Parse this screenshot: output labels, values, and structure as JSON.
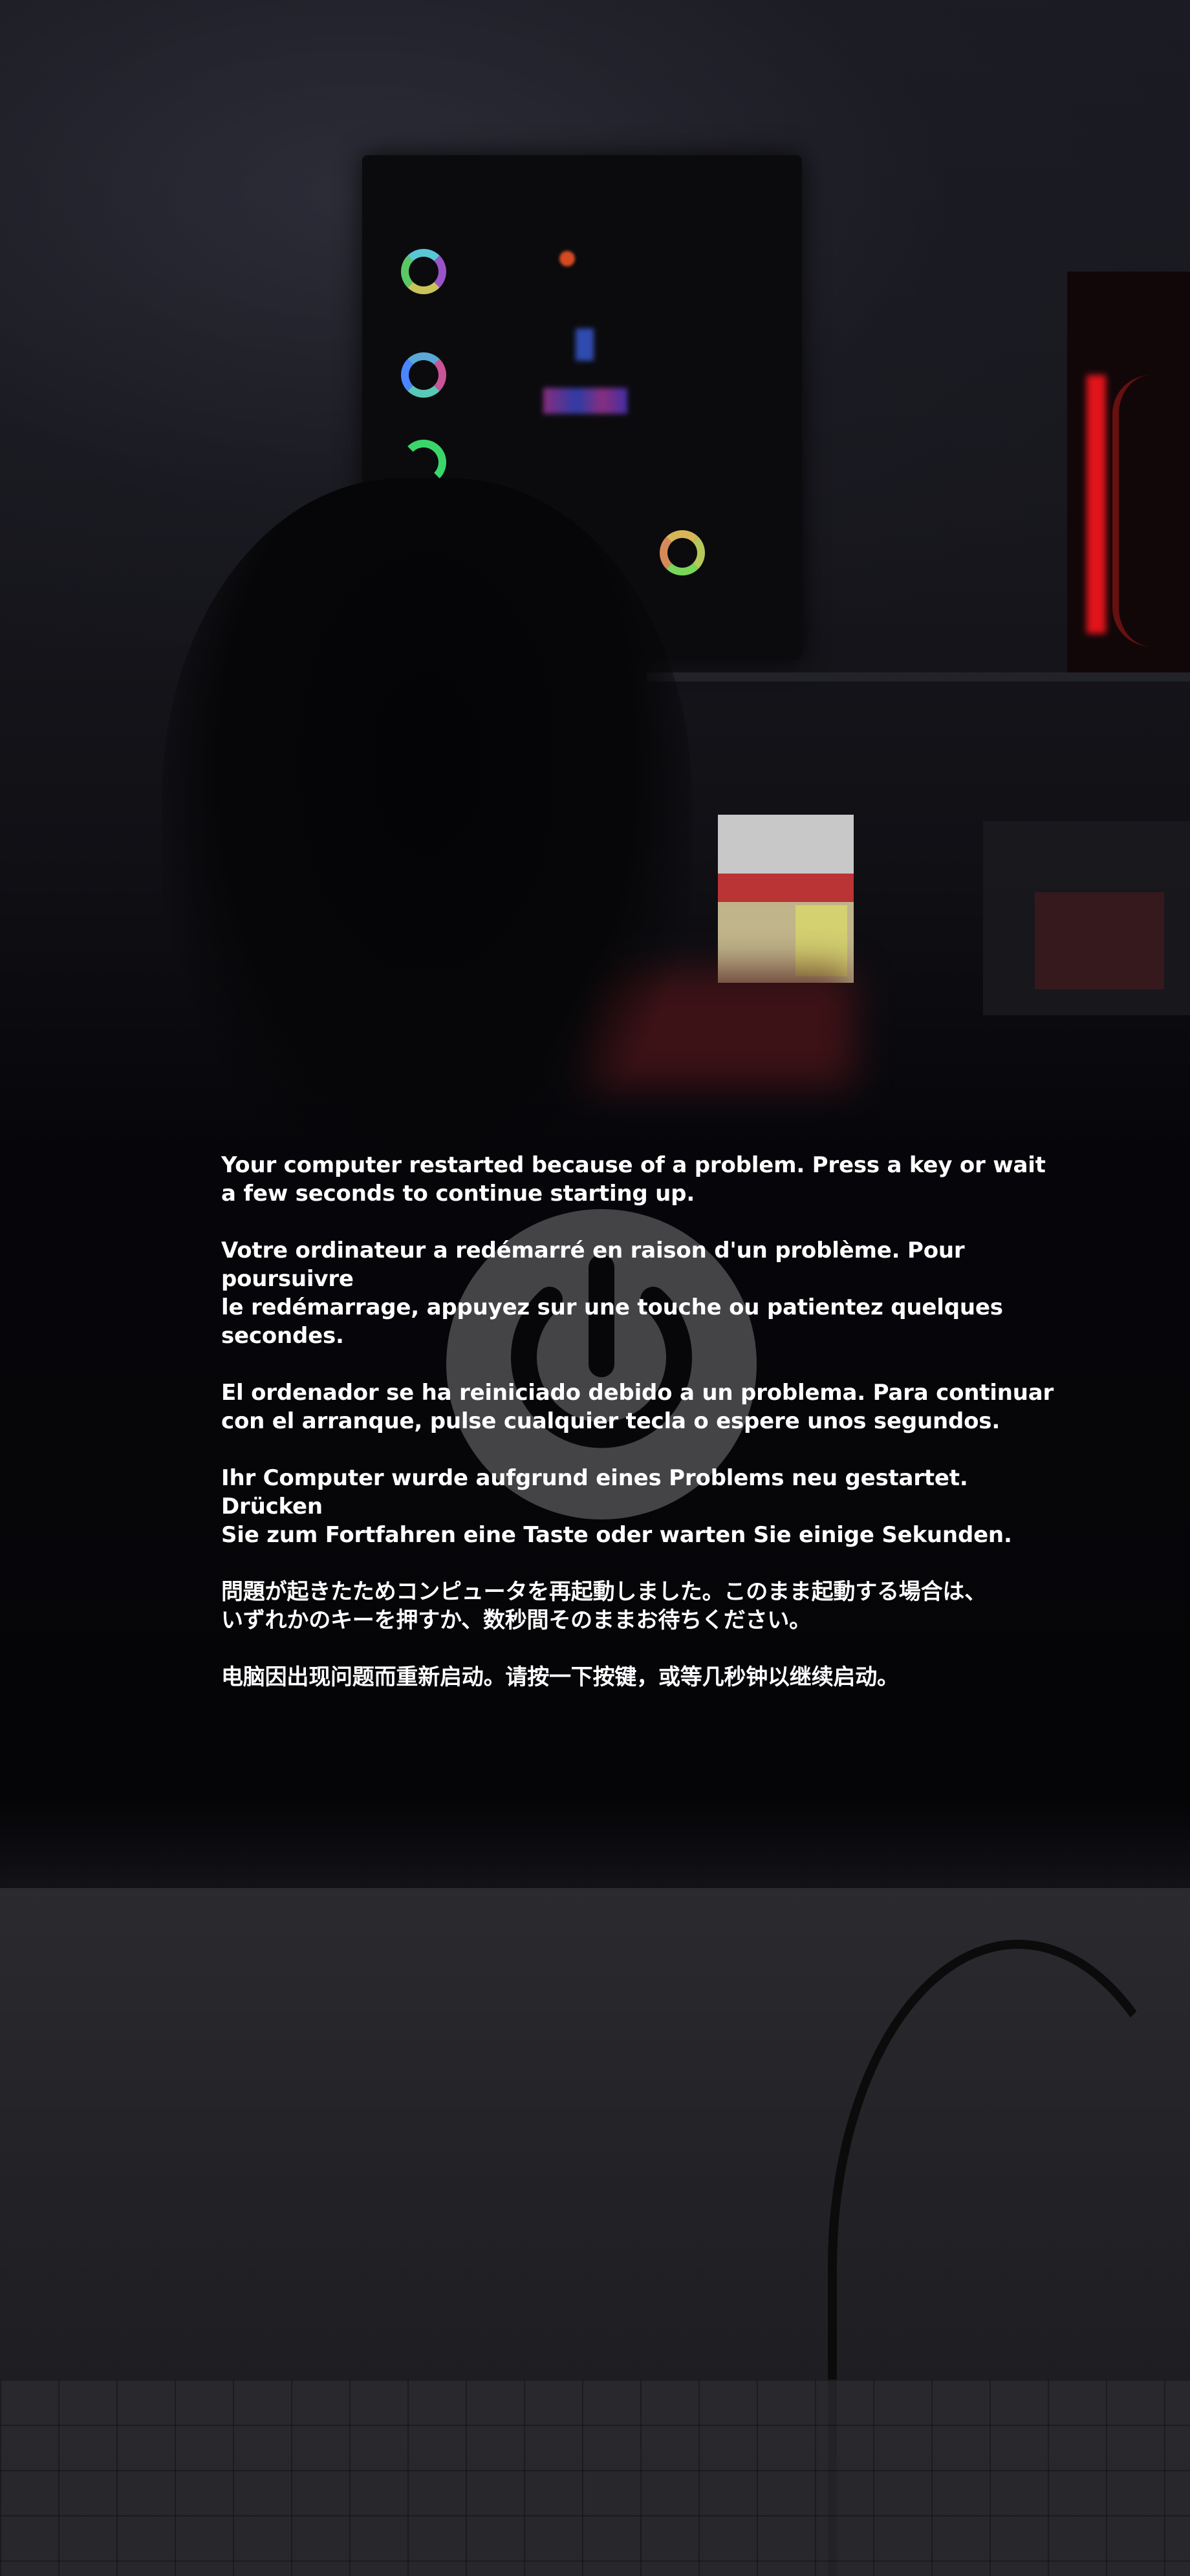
{
  "screen": {
    "type": "kernel-panic-restart-screen",
    "text_color": "#ffffff",
    "background_color": "#06060a",
    "icon": "power-icon"
  },
  "messages": [
    {
      "lang": "en",
      "text": "Your computer restarted because of a problem. Press a key or wait\na few seconds to continue starting up."
    },
    {
      "lang": "fr",
      "text": "Votre ordinateur a redémarré en raison d'un problème. Pour poursuivre\nle redémarrage, appuyez sur une touche ou patientez quelques secondes."
    },
    {
      "lang": "es",
      "text": "El ordenador se ha reiniciado debido a un problema. Para continuar\ncon el arranque, pulse cualquier tecla o espere unos segundos."
    },
    {
      "lang": "de",
      "text": "Ihr Computer wurde aufgrund eines Problems neu gestartet. Drücken\nSie zum Fortfahren eine Taste oder warten Sie einige Sekunden."
    },
    {
      "lang": "ja",
      "text": "問題が起きたためコンピュータを再起動しました。このまま起動する場合は、\nいずれかのキーを押すか、数秒間そのままお待ちください。"
    },
    {
      "lang": "zh",
      "text": "电脑因出现问题而重新启动。请按一下按键，或等几秒钟以继续启动。"
    }
  ]
}
